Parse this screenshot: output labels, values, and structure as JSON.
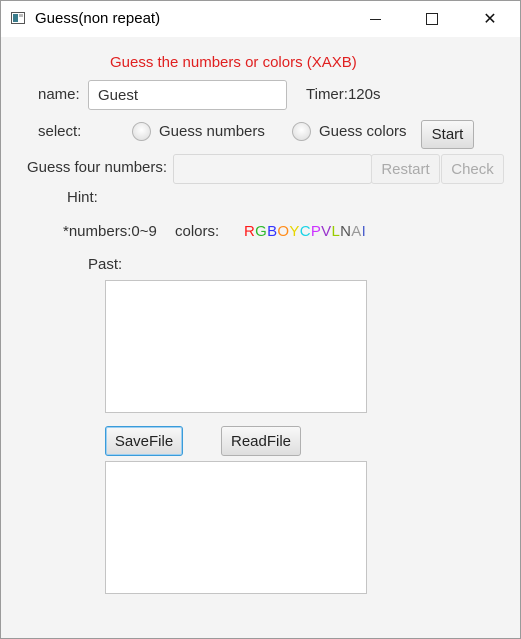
{
  "window": {
    "title": "Guess(non repeat)",
    "controls": {
      "minimize": "minimize",
      "maximize": "maximize",
      "close": "✕"
    }
  },
  "header": {
    "title": "Guess the numbers or colors (XAXB)",
    "title_color": "#e02020"
  },
  "name_row": {
    "label": "name:",
    "value": "Guest",
    "timer": "Timer:120s"
  },
  "select_row": {
    "label": "select:",
    "option_numbers": "Guess numbers",
    "option_colors": "Guess colors",
    "start_label": "Start"
  },
  "guess_row": {
    "label": "Guess four numbers:",
    "value": "",
    "restart_label": "Restart",
    "check_label": "Check"
  },
  "hint": {
    "label": "Hint:"
  },
  "legend": {
    "numbers_text": "*numbers:0~9",
    "colors_label": "colors:",
    "color_letters": [
      {
        "letter": "R",
        "color": "#ff1a1a"
      },
      {
        "letter": "G",
        "color": "#2db92d"
      },
      {
        "letter": "B",
        "color": "#3333ff"
      },
      {
        "letter": "O",
        "color": "#ff8c1a"
      },
      {
        "letter": "Y",
        "color": "#e6d600"
      },
      {
        "letter": "C",
        "color": "#19d3e6"
      },
      {
        "letter": "P",
        "color": "#cc33ff"
      },
      {
        "letter": "V",
        "color": "#9933cc"
      },
      {
        "letter": "L",
        "color": "#99cc00"
      },
      {
        "letter": "N",
        "color": "#555555"
      },
      {
        "letter": "A",
        "color": "#999999"
      },
      {
        "letter": "I",
        "color": "#4b5fcc"
      }
    ]
  },
  "past": {
    "label": "Past:"
  },
  "file_buttons": {
    "save_label": "SaveFile",
    "read_label": "ReadFile"
  }
}
